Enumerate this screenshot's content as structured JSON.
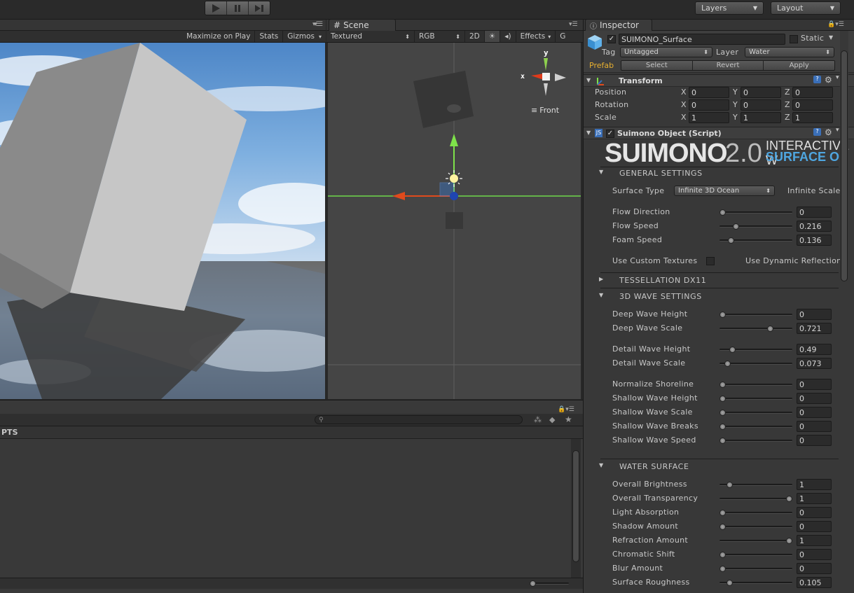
{
  "toolbar": {
    "play_icon": "play-icon",
    "pause_icon": "pause-icon",
    "step_icon": "step-icon",
    "layers_label": "Layers",
    "layout_label": "Layout"
  },
  "game_view": {
    "maximize_label": "Maximize on Play",
    "stats_label": "Stats",
    "gizmos_label": "Gizmos"
  },
  "scene_view": {
    "tab_label": "Scene",
    "render_mode": "Textured",
    "channel": "RGB",
    "mode_2d": "2D",
    "effects_label": "Effects",
    "gizmo_x": "x",
    "gizmo_y": "y",
    "view_label": "Front"
  },
  "project_panel": {
    "folder_label": "PTS",
    "search_placeholder": ""
  },
  "inspector": {
    "tab_label": "Inspector",
    "object_name": "SUIMONO_Surface",
    "static_label": "Static",
    "tag_label": "Tag",
    "tag_value": "Untagged",
    "layer_label": "Layer",
    "layer_value": "Water",
    "prefab_label": "Prefab",
    "select_label": "Select",
    "revert_label": "Revert",
    "apply_label": "Apply",
    "transform": {
      "title": "Transform",
      "rows": [
        {
          "label": "Position",
          "x": "0",
          "y": "0",
          "z": "0"
        },
        {
          "label": "Rotation",
          "x": "0",
          "y": "0",
          "z": "0"
        },
        {
          "label": "Scale",
          "x": "1",
          "y": "1",
          "z": "1"
        }
      ],
      "axis_x": "X",
      "axis_y": "Y",
      "axis_z": "Z"
    },
    "script": {
      "title": "Suimono Object (Script)",
      "banner_main": "SUIMONO",
      "banner_version": "2.0",
      "banner_top": "INTERACTIVE W",
      "banner_bottom": "SURFACE OB"
    },
    "general": {
      "title": "GENERAL SETTINGS",
      "surface_type_label": "Surface Type",
      "surface_type_value": "Infinite 3D Ocean",
      "infinite_scale_label": "Infinite Scale",
      "sliders": [
        {
          "label": "Flow Direction",
          "value": "0",
          "frac": 0.0
        },
        {
          "label": "Flow Speed",
          "value": "0.216",
          "frac": 0.2
        },
        {
          "label": "Foam Speed",
          "value": "0.136",
          "frac": 0.13
        }
      ],
      "custom_textures_label": "Use Custom Textures",
      "dynamic_reflection_label": "Use Dynamic Reflection"
    },
    "tessellation": {
      "title": "TESSELLATION DX11"
    },
    "wave": {
      "title": "3D WAVE SETTINGS",
      "groups": [
        [
          {
            "label": "Deep Wave Height",
            "value": "0",
            "frac": 0.0
          },
          {
            "label": "Deep Wave Scale",
            "value": "0.721",
            "frac": 0.72
          }
        ],
        [
          {
            "label": "Detail Wave Height",
            "value": "0.49",
            "frac": 0.15
          },
          {
            "label": "Detail Wave Scale",
            "value": "0.073",
            "frac": 0.07
          }
        ],
        [
          {
            "label": "Normalize Shoreline",
            "value": "0",
            "frac": 0.0
          },
          {
            "label": "Shallow Wave Height",
            "value": "0",
            "frac": 0.0
          },
          {
            "label": "Shallow Wave Scale",
            "value": "0",
            "frac": 0.0
          },
          {
            "label": "Shallow Wave Breaks",
            "value": "0",
            "frac": 0.0
          },
          {
            "label": "Shallow Wave Speed",
            "value": "0",
            "frac": 0.0
          }
        ]
      ]
    },
    "water_surface": {
      "title": "WATER SURFACE",
      "sliders": [
        {
          "label": "Overall Brightness",
          "value": "1",
          "frac": 0.1
        },
        {
          "label": "Overall Transparency",
          "value": "1",
          "frac": 1.0
        },
        {
          "label": "Light Absorption",
          "value": "0",
          "frac": 0.0
        },
        {
          "label": "Shadow Amount",
          "value": "0",
          "frac": 0.0
        },
        {
          "label": "Refraction Amount",
          "value": "1",
          "frac": 1.0
        },
        {
          "label": "Chromatic Shift",
          "value": "0",
          "frac": 0.0
        },
        {
          "label": "Blur Amount",
          "value": "0",
          "frac": 0.0
        },
        {
          "label": "Surface Roughness",
          "value": "0.105",
          "frac": 0.1
        }
      ]
    }
  },
  "colors": {
    "accent_blue": "#3a6fb8",
    "prefab_orange": "#e8b030",
    "axis_green": "#7ee24a",
    "axis_red": "#e04a1c"
  }
}
